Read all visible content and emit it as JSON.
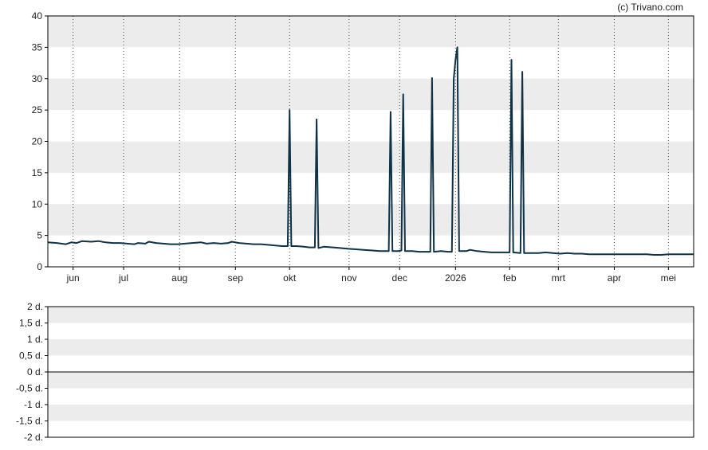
{
  "credit": "(c) Trivano.com",
  "colors": {
    "line": "#0f3246",
    "band": "#ececec",
    "frame": "#000000",
    "grid": "#444444",
    "text": "#222222"
  },
  "chart_data": [
    {
      "type": "line",
      "xlim": [
        0,
        358
      ],
      "ylim": [
        0,
        40
      ],
      "yticks": [
        0,
        5,
        10,
        15,
        20,
        25,
        30,
        35,
        40
      ],
      "ytick_labels": [
        "0",
        "5",
        "10",
        "15",
        "20",
        "25",
        "30",
        "35",
        "40"
      ],
      "xticks": [
        {
          "label": "jun",
          "x": 14
        },
        {
          "label": "jul",
          "x": 42
        },
        {
          "label": "aug",
          "x": 73
        },
        {
          "label": "sep",
          "x": 104
        },
        {
          "label": "okt",
          "x": 134
        },
        {
          "label": "nov",
          "x": 167
        },
        {
          "label": "dec",
          "x": 195
        },
        {
          "label": "2026",
          "x": 226
        },
        {
          "label": "feb",
          "x": 256
        },
        {
          "label": "mrt",
          "x": 283
        },
        {
          "label": "apr",
          "x": 314
        },
        {
          "label": "mei",
          "x": 344
        }
      ],
      "grid": "vertical dotted at month ticks, alternating horizontal bands",
      "series": [
        {
          "points": [
            [
              0,
              3.9
            ],
            [
              5,
              3.8
            ],
            [
              10,
              3.6
            ],
            [
              13,
              3.9
            ],
            [
              16,
              3.8
            ],
            [
              19,
              4.1
            ],
            [
              24,
              4.0
            ],
            [
              28,
              4.1
            ],
            [
              32,
              3.9
            ],
            [
              36,
              3.8
            ],
            [
              40,
              3.8
            ],
            [
              44,
              3.7
            ],
            [
              48,
              3.6
            ],
            [
              50,
              3.8
            ],
            [
              54,
              3.7
            ],
            [
              56,
              4.0
            ],
            [
              60,
              3.8
            ],
            [
              64,
              3.7
            ],
            [
              68,
              3.6
            ],
            [
              72,
              3.6
            ],
            [
              76,
              3.7
            ],
            [
              80,
              3.8
            ],
            [
              85,
              3.9
            ],
            [
              88,
              3.7
            ],
            [
              92,
              3.8
            ],
            [
              96,
              3.7
            ],
            [
              100,
              3.8
            ],
            [
              102,
              4.0
            ],
            [
              106,
              3.8
            ],
            [
              110,
              3.7
            ],
            [
              114,
              3.6
            ],
            [
              118,
              3.6
            ],
            [
              122,
              3.5
            ],
            [
              126,
              3.4
            ],
            [
              130,
              3.3
            ],
            [
              133,
              3.3
            ],
            [
              134,
              25.0
            ],
            [
              135,
              3.3
            ],
            [
              138,
              3.3
            ],
            [
              142,
              3.2
            ],
            [
              145,
              3.1
            ],
            [
              148,
              3.1
            ],
            [
              149,
              23.5
            ],
            [
              150,
              3.0
            ],
            [
              153,
              3.2
            ],
            [
              158,
              3.1
            ],
            [
              162,
              3.0
            ],
            [
              166,
              2.9
            ],
            [
              170,
              2.8
            ],
            [
              175,
              2.7
            ],
            [
              180,
              2.6
            ],
            [
              184,
              2.5
            ],
            [
              188,
              2.5
            ],
            [
              189,
              2.5
            ],
            [
              190,
              24.7
            ],
            [
              191,
              2.5
            ],
            [
              194,
              2.5
            ],
            [
              196,
              2.6
            ],
            [
              197,
              27.5
            ],
            [
              198,
              2.5
            ],
            [
              202,
              2.5
            ],
            [
              206,
              2.4
            ],
            [
              210,
              2.4
            ],
            [
              212,
              2.4
            ],
            [
              213,
              30.1
            ],
            [
              214,
              2.4
            ],
            [
              218,
              2.5
            ],
            [
              222,
              2.4
            ],
            [
              224,
              2.4
            ],
            [
              225,
              30.0
            ],
            [
              226,
              33.0
            ],
            [
              227,
              35.0
            ],
            [
              228,
              2.5
            ],
            [
              232,
              2.5
            ],
            [
              234,
              2.7
            ],
            [
              238,
              2.5
            ],
            [
              242,
              2.4
            ],
            [
              246,
              2.3
            ],
            [
              250,
              2.3
            ],
            [
              254,
              2.3
            ],
            [
              256,
              2.3
            ],
            [
              257,
              33.0
            ],
            [
              258,
              2.3
            ],
            [
              262,
              2.2
            ],
            [
              263,
              31.1
            ],
            [
              264,
              2.2
            ],
            [
              268,
              2.2
            ],
            [
              272,
              2.2
            ],
            [
              276,
              2.3
            ],
            [
              280,
              2.2
            ],
            [
              284,
              2.1
            ],
            [
              288,
              2.2
            ],
            [
              292,
              2.1
            ],
            [
              296,
              2.1
            ],
            [
              300,
              2.0
            ],
            [
              304,
              2.0
            ],
            [
              308,
              2.0
            ],
            [
              312,
              2.0
            ],
            [
              316,
              2.0
            ],
            [
              320,
              2.0
            ],
            [
              324,
              2.0
            ],
            [
              328,
              2.0
            ],
            [
              332,
              2.0
            ],
            [
              336,
              1.9
            ],
            [
              340,
              1.9
            ],
            [
              344,
              2.0
            ],
            [
              348,
              2.0
            ],
            [
              352,
              2.0
            ],
            [
              358,
              2.0
            ]
          ]
        }
      ]
    },
    {
      "type": "line",
      "ylim": [
        -2,
        2
      ],
      "yticks": [
        2,
        1.5,
        1,
        0.5,
        0,
        -0.5,
        -1,
        -1.5,
        -2
      ],
      "ytick_labels": [
        "2 d.",
        "1,5 d.",
        "1 d.",
        "0,5 d.",
        "0 d.",
        "-0,5 d.",
        "-1 d.",
        "-1,5 d.",
        "-2 d."
      ],
      "grid": "alternating horizontal bands, solid zero line",
      "series": []
    }
  ]
}
